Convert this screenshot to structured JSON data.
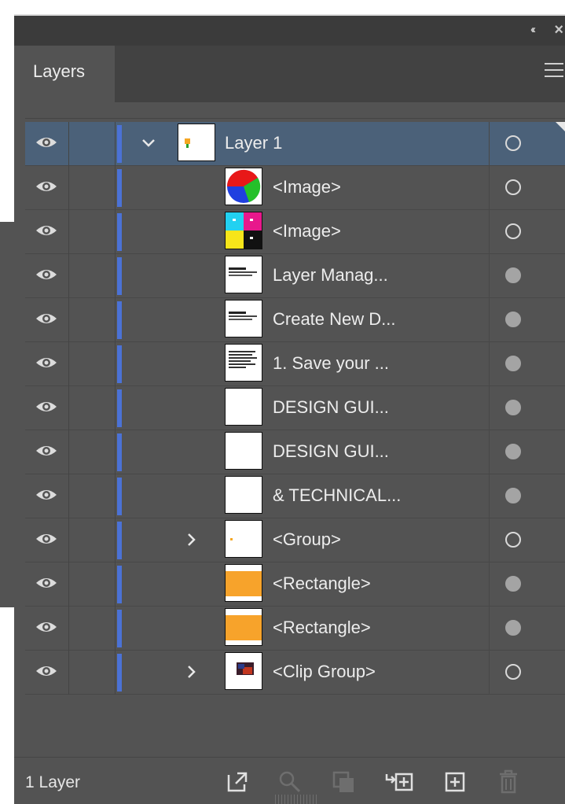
{
  "panel": {
    "title_tab": "Layers",
    "footer_count": "1 Layer"
  },
  "titlebar": {
    "collapse_icon": "double-chevron-left-icon",
    "close_icon": "close-icon"
  },
  "colors": {
    "panel_bg": "#535353",
    "selected_row": "#4b6179",
    "layer_color": "#4b72d6",
    "text": "#ededed"
  },
  "layers": [
    {
      "name": "Layer 1",
      "thumb": "layer",
      "target_filled": false,
      "selected": true,
      "expandable": true,
      "expanded": true,
      "level": 0
    },
    {
      "name": "<Image>",
      "thumb": "rgb-circle",
      "target_filled": false,
      "selected": false,
      "expandable": false,
      "level": 1
    },
    {
      "name": "<Image>",
      "thumb": "cmyk",
      "target_filled": false,
      "selected": false,
      "expandable": false,
      "level": 1
    },
    {
      "name": "Layer Manag...",
      "thumb": "text-sparse",
      "target_filled": true,
      "selected": false,
      "expandable": false,
      "level": 1
    },
    {
      "name": "Create New D...",
      "thumb": "text-sparse",
      "target_filled": true,
      "selected": false,
      "expandable": false,
      "level": 1
    },
    {
      "name": "1. Save your ...",
      "thumb": "text-dense",
      "target_filled": true,
      "selected": false,
      "expandable": false,
      "level": 1
    },
    {
      "name": "DESIGN GUI...",
      "thumb": "blank",
      "target_filled": true,
      "selected": false,
      "expandable": false,
      "level": 1
    },
    {
      "name": "DESIGN GUI...",
      "thumb": "blank",
      "target_filled": true,
      "selected": false,
      "expandable": false,
      "level": 1
    },
    {
      "name": "& TECHNICAL...",
      "thumb": "blank",
      "target_filled": true,
      "selected": false,
      "expandable": false,
      "level": 1
    },
    {
      "name": "<Group>",
      "thumb": "group",
      "target_filled": false,
      "selected": false,
      "expandable": true,
      "expanded": false,
      "level": 1
    },
    {
      "name": "<Rectangle>",
      "thumb": "orange",
      "target_filled": true,
      "selected": false,
      "expandable": false,
      "level": 1
    },
    {
      "name": "<Rectangle>",
      "thumb": "orange",
      "target_filled": true,
      "selected": false,
      "expandable": false,
      "level": 1
    },
    {
      "name": "<Clip Group>",
      "thumb": "clip",
      "target_filled": false,
      "selected": false,
      "expandable": true,
      "expanded": false,
      "level": 1
    }
  ],
  "footer_buttons": [
    {
      "name": "export-icon",
      "enabled": true
    },
    {
      "name": "locate-object-icon",
      "enabled": false
    },
    {
      "name": "make-clipping-mask-icon",
      "enabled": false
    },
    {
      "name": "create-sublayer-icon",
      "enabled": true
    },
    {
      "name": "create-layer-icon",
      "enabled": true
    },
    {
      "name": "delete-icon",
      "enabled": false
    }
  ]
}
